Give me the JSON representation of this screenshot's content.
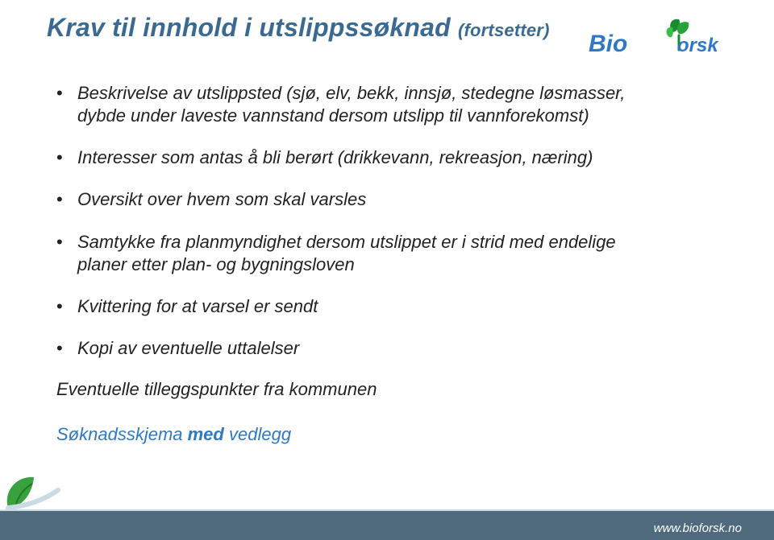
{
  "title": {
    "main": "Krav til innhold i utslippssøknad",
    "suffix": "(fortsetter)"
  },
  "logo": {
    "name": "Bioforsk",
    "green": "#1b8b2f",
    "blue": "#2f78c6"
  },
  "bullets": [
    "Beskrivelse av utslippsted (sjø, elv, bekk, innsjø, stedegne løsmasser, dybde under laveste vannstand dersom utslipp til vannforekomst)",
    "Interesser som antas å bli berørt (drikkevann, rekreasjon, næring)",
    "Oversikt over hvem som skal varsles",
    "Samtykke fra planmyndighet dersom utslippet er i strid med endelige planer etter plan- og bygningsloven",
    "Kvittering for at varsel er sendt",
    "Kopi av eventuelle uttalelser"
  ],
  "extra_line": "Eventuelle tilleggspunkter fra kommunen",
  "link": {
    "prefix": "Søknadsskjema ",
    "bold": "med",
    "suffix": " vedlegg"
  },
  "footer": {
    "url": "www.bioforsk.no",
    "leaf_color": "#3aa13f"
  },
  "colors": {
    "title": "#3a6a91",
    "link": "#2f78c6",
    "bar_dark": "#506a7d",
    "bar_light": "#cadbe6"
  }
}
